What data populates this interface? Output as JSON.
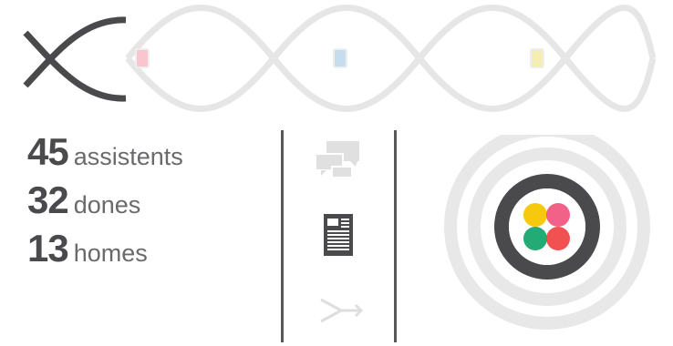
{
  "progress": {
    "steps": [
      {
        "name": "step-1",
        "done": true,
        "color": "#4a4a4d"
      },
      {
        "name": "step-2",
        "done": false,
        "marker_color": "#f9c6cf"
      },
      {
        "name": "step-3",
        "done": false,
        "marker_color": "#c7dced"
      },
      {
        "name": "step-4",
        "done": false,
        "marker_color": "#f4eeb2"
      }
    ],
    "inactive_color": "#e6e6e6"
  },
  "stats": [
    {
      "number": "45",
      "label": "assistents"
    },
    {
      "number": "32",
      "label": "dones"
    },
    {
      "number": "13",
      "label": "homes"
    }
  ],
  "icons": [
    {
      "name": "chat-bubbles-icon",
      "active": false
    },
    {
      "name": "document-icon",
      "active": true
    },
    {
      "name": "merge-arrows-icon",
      "active": false
    }
  ],
  "target": {
    "ring_color": "#e8e8e8",
    "dark_ring_color": "#4a4a4d",
    "dots": [
      "#f7c600",
      "#f0507b",
      "#17a56e",
      "#ef3e3e"
    ]
  }
}
